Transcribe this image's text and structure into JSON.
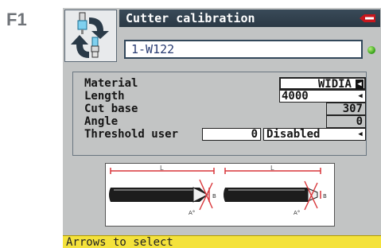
{
  "function_key": "F1",
  "window": {
    "title": "Cutter calibration",
    "key_code": "1-W122",
    "status_led_color": "#2f9d13"
  },
  "parameters": {
    "material": {
      "label": "Material",
      "value": "WIDIA"
    },
    "length": {
      "label": "Length",
      "value": "4000"
    },
    "cut_base": {
      "label": "Cut base",
      "value": "307"
    },
    "angle": {
      "label": "Angle",
      "value": "0"
    },
    "threshold": {
      "label": "Threshold user",
      "value": "0",
      "mode": "Disabled"
    }
  },
  "illustration": {
    "length_mark": "L",
    "angle_mark": "A°",
    "base_mark": "B"
  },
  "status": {
    "message": "Arrows to select"
  },
  "colors": {
    "title_bar": "#2f3e4b",
    "status_bar": "#f4e23c",
    "dimension_lines": "#d9363a"
  }
}
